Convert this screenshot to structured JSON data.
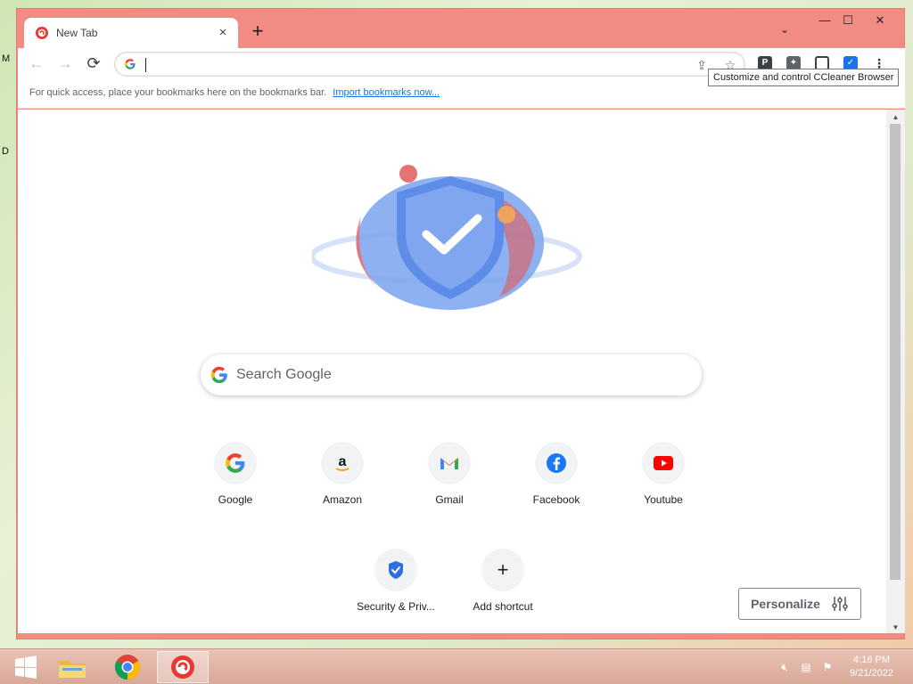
{
  "browser": {
    "tab_title": "New Tab",
    "tab_close": "×",
    "new_tab_label": "+",
    "window_controls": {
      "minimize": "—",
      "maximize": "☐",
      "close": "✕"
    },
    "tab_search": "⌄"
  },
  "toolbar": {
    "back": "←",
    "forward": "→",
    "reload": "⟳",
    "omnibox_value": "",
    "tooltip": "Customize and control CCleaner Browser"
  },
  "bookmarks_bar": {
    "text": "For quick access, place your bookmarks here on the bookmarks bar.",
    "import_link": "Import bookmarks now..."
  },
  "ntp": {
    "search_placeholder": "Search Google",
    "shortcuts": [
      {
        "label": "Google",
        "icon": "google-icon"
      },
      {
        "label": "Amazon",
        "icon": "amazon-icon"
      },
      {
        "label": "Gmail",
        "icon": "gmail-icon"
      },
      {
        "label": "Facebook",
        "icon": "facebook-icon"
      },
      {
        "label": "Youtube",
        "icon": "youtube-icon"
      },
      {
        "label": "Security & Priv...",
        "icon": "shield-icon"
      },
      {
        "label": "Add shortcut",
        "icon": "plus-icon"
      }
    ],
    "personalize_label": "Personalize"
  },
  "desktop": {
    "letters": [
      "M",
      "D"
    ]
  },
  "taskbar": {
    "time": "4:16 PM",
    "date": "9/21/2022"
  },
  "colors": {
    "frame": "#f28b82",
    "accent": "#1a73e8"
  }
}
